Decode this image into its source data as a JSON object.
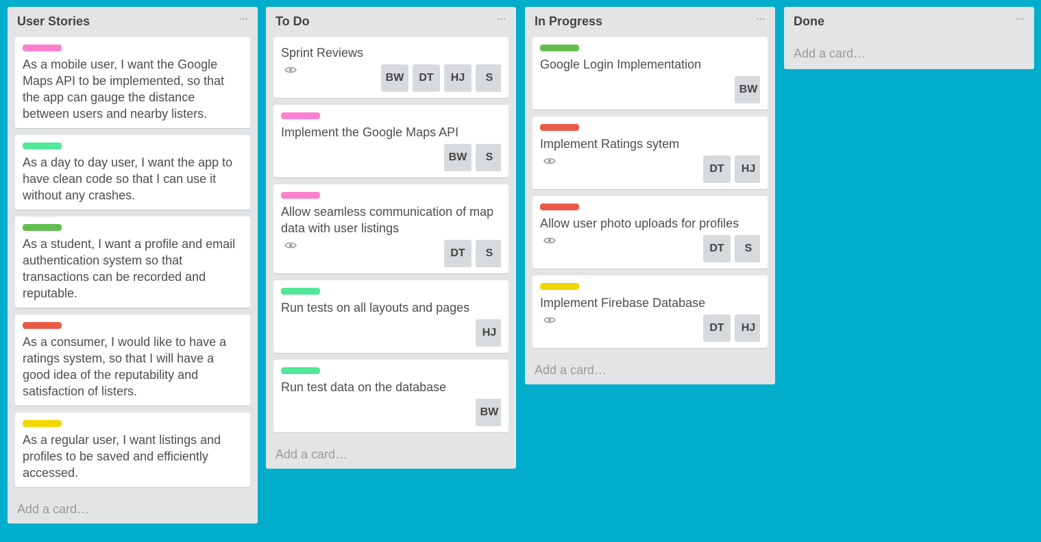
{
  "colors": {
    "board_bg": "#00AECC",
    "list_bg": "#E2E4E6",
    "pink": "#FF80CE",
    "teal": "#51E898",
    "green": "#61BD4F",
    "red": "#EB5A46",
    "yellow": "#F2D600"
  },
  "lists": [
    {
      "title": "User Stories",
      "menu": "···",
      "add_card": "Add a card…",
      "cards": [
        {
          "label_color": "pink",
          "title": "As a mobile user, I want the Google Maps API to be implemented, so that the app can gauge the distance between users and nearby listers.",
          "watch": false,
          "members": []
        },
        {
          "label_color": "teal",
          "title": "As a day to day user, I want the app to have clean code so that I can use it without any crashes.",
          "watch": false,
          "members": []
        },
        {
          "label_color": "green",
          "title": "As a student, I want a profile and email authentication system so that transactions can be recorded and reputable.",
          "watch": false,
          "members": []
        },
        {
          "label_color": "red",
          "title": "As a consumer, I would like to have a ratings system, so that I will have a good idea of the reputability and satisfaction of listers.",
          "watch": false,
          "members": []
        },
        {
          "label_color": "yellow",
          "title": "As a regular user, I want listings and profiles to be saved and efficiently accessed.",
          "watch": false,
          "members": []
        }
      ]
    },
    {
      "title": "To Do",
      "menu": "···",
      "add_card": "Add a card…",
      "cards": [
        {
          "label_color": null,
          "title": "Sprint Reviews",
          "watch": true,
          "members": [
            "BW",
            "DT",
            "HJ",
            "S"
          ]
        },
        {
          "label_color": "pink",
          "title": "Implement the Google Maps API",
          "watch": false,
          "members": [
            "BW",
            "S"
          ]
        },
        {
          "label_color": "pink",
          "title": "Allow seamless communication of map data with user listings",
          "watch": true,
          "members": [
            "DT",
            "S"
          ]
        },
        {
          "label_color": "teal",
          "title": "Run tests on all layouts and pages",
          "watch": false,
          "members": [
            "HJ"
          ]
        },
        {
          "label_color": "teal",
          "title": "Run test data on the database",
          "watch": false,
          "members": [
            "BW"
          ]
        }
      ]
    },
    {
      "title": "In Progress",
      "menu": "···",
      "add_card": "Add a card…",
      "cards": [
        {
          "label_color": "green",
          "title": "Google Login Implementation",
          "watch": false,
          "members": [
            "BW"
          ]
        },
        {
          "label_color": "red",
          "title": "Implement Ratings sytem",
          "watch": true,
          "members": [
            "DT",
            "HJ"
          ]
        },
        {
          "label_color": "red",
          "title": "Allow user photo uploads for profiles",
          "watch": true,
          "members": [
            "DT",
            "S"
          ]
        },
        {
          "label_color": "yellow",
          "title": "Implement Firebase Database",
          "watch": true,
          "members": [
            "DT",
            "HJ"
          ]
        }
      ]
    },
    {
      "title": "Done",
      "menu": "···",
      "add_card": "Add a card…",
      "cards": []
    }
  ]
}
